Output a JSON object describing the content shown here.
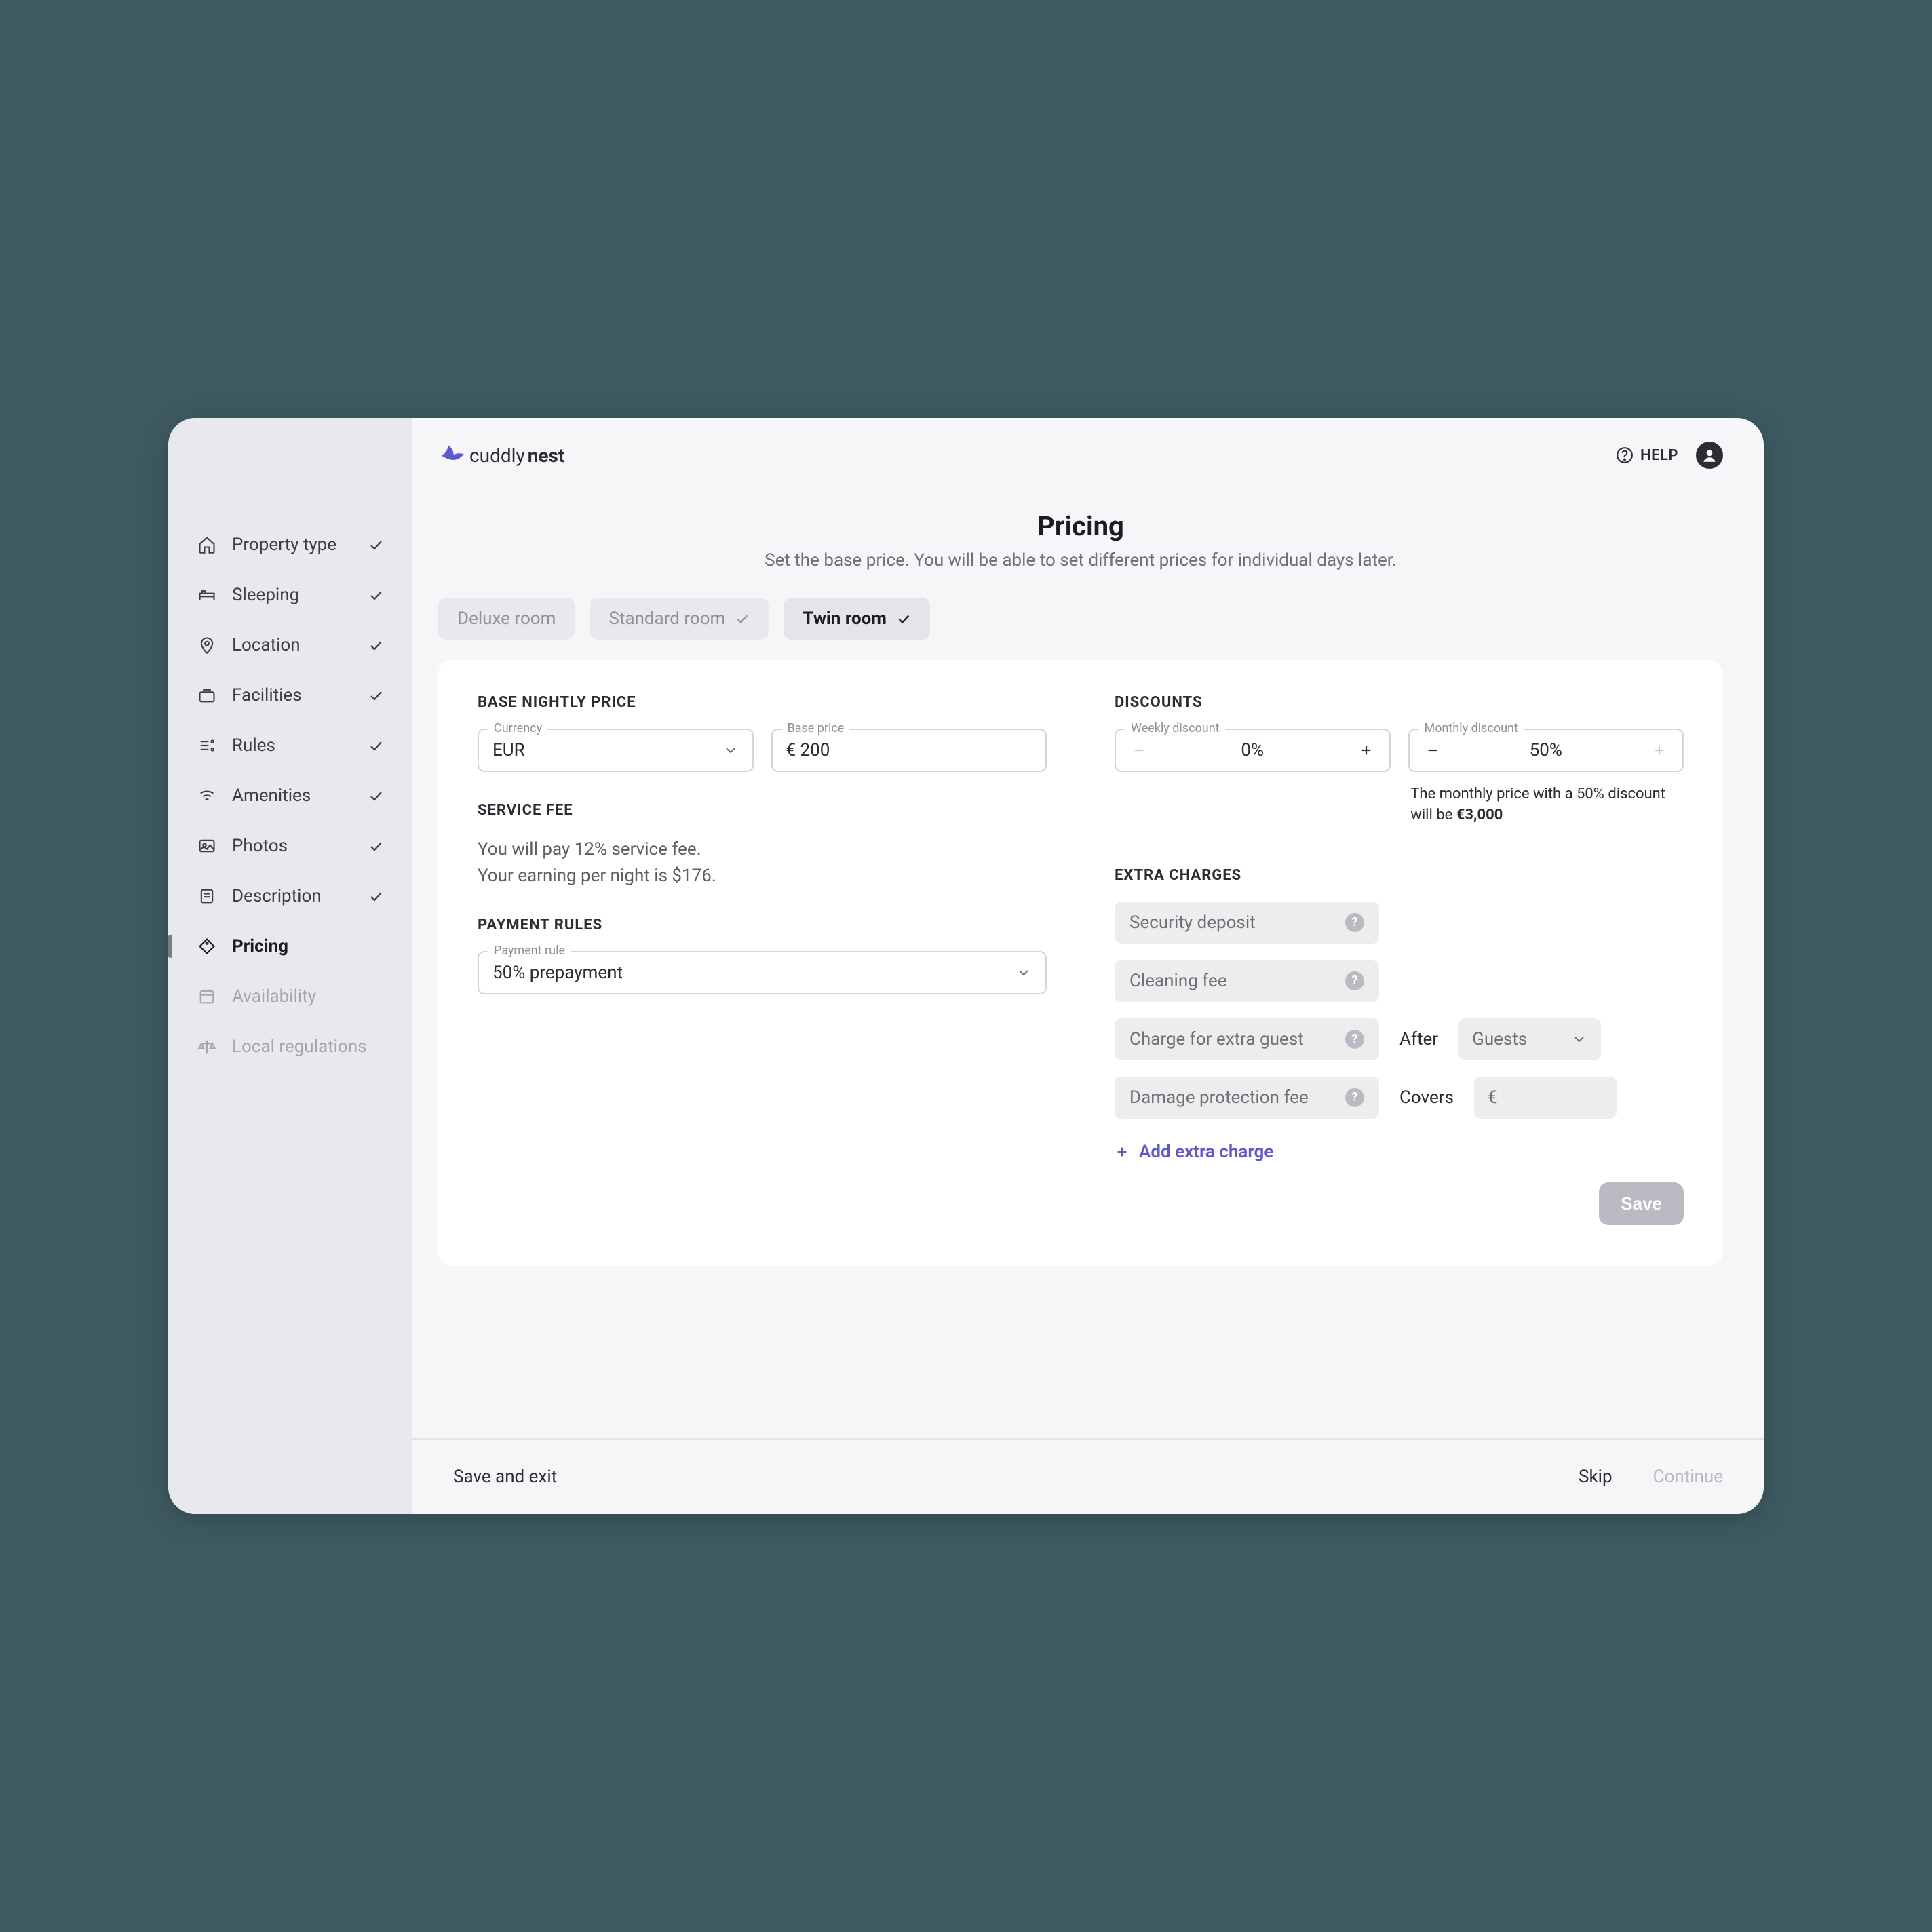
{
  "brand": {
    "name_light": "cuddly",
    "name_bold": "nest"
  },
  "help_label": "HELP",
  "sidebar": {
    "items": [
      {
        "label": "Property type",
        "icon": "home",
        "done": true
      },
      {
        "label": "Sleeping",
        "icon": "bed",
        "done": true
      },
      {
        "label": "Location",
        "icon": "pin",
        "done": true
      },
      {
        "label": "Facilities",
        "icon": "case",
        "done": true
      },
      {
        "label": "Rules",
        "icon": "rules",
        "done": true
      },
      {
        "label": "Amenities",
        "icon": "wifi",
        "done": true
      },
      {
        "label": "Photos",
        "icon": "photo",
        "done": true
      },
      {
        "label": "Description",
        "icon": "doc",
        "done": true
      },
      {
        "label": "Pricing",
        "icon": "tag",
        "done": false,
        "active": true
      },
      {
        "label": "Availability",
        "icon": "calendar",
        "done": false,
        "disabled": true
      },
      {
        "label": "Local regulations",
        "icon": "scales",
        "done": false,
        "disabled": true
      }
    ]
  },
  "page": {
    "title": "Pricing",
    "subtitle": "Set the base price. You will be able to set different prices for individual days later."
  },
  "room_tabs": [
    {
      "label": "Deluxe room",
      "done": false
    },
    {
      "label": "Standard room",
      "done": true
    },
    {
      "label": "Twin room",
      "done": true,
      "active": true
    }
  ],
  "base_price": {
    "heading": "BASE NIGHTLY PRICE",
    "currency_label": "Currency",
    "currency_value": "EUR",
    "price_label": "Base price",
    "price_value": "€ 200"
  },
  "service_fee": {
    "heading": "SERVICE FEE",
    "line1": "You will pay 12% service fee.",
    "line2": "Your earning per night is $176."
  },
  "payment_rules": {
    "heading": "PAYMENT RULES",
    "field_label": "Payment rule",
    "value": "50% prepayment"
  },
  "discounts": {
    "heading": "DISCOUNTS",
    "weekly_label": "Weekly discount",
    "weekly_value": "0%",
    "monthly_label": "Monthly discount",
    "monthly_value": "50%",
    "note_prefix": "The monthly price with a 50% discount will be ",
    "note_value": "€3,000"
  },
  "extra_charges": {
    "heading": "EXTRA CHARGES",
    "items": [
      {
        "label": "Security deposit"
      },
      {
        "label": "Cleaning fee"
      },
      {
        "label": "Charge for extra guest",
        "aux_label": "After",
        "aux_field": "Guests",
        "aux_type": "select"
      },
      {
        "label": "Damage protection fee",
        "aux_label": "Covers",
        "aux_field": "€",
        "aux_type": "input"
      }
    ],
    "add_label": "Add extra charge"
  },
  "save_label": "Save",
  "footer": {
    "save_exit": "Save and exit",
    "skip": "Skip",
    "continue": "Continue"
  }
}
